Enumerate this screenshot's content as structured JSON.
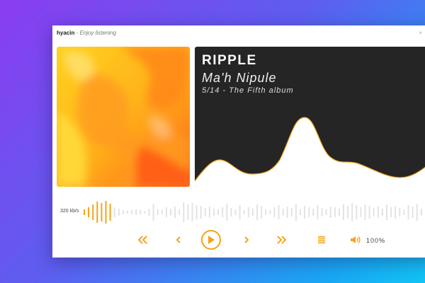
{
  "window": {
    "app_name": "hyacin",
    "separator": " - ",
    "tagline": "Enjoy listening",
    "close_glyph": "×"
  },
  "track": {
    "title": "RIPPLE",
    "artist": "Ma'h Nipule",
    "album_line": "5/14 - The Fifth album"
  },
  "player": {
    "bitrate": "320 kb/s",
    "progress": 0.09,
    "volume": "100%",
    "accent_color": "#f5a31a",
    "inactive_bar_color": "#e3e3e3",
    "panel_color": "#252525"
  },
  "icons": {
    "fast_rewind": "fast-rewind-icon",
    "previous": "previous-icon",
    "play": "play-icon",
    "next": "next-icon",
    "fast_forward": "fast-forward-icon",
    "playlist": "playlist-icon",
    "volume": "volume-icon"
  }
}
